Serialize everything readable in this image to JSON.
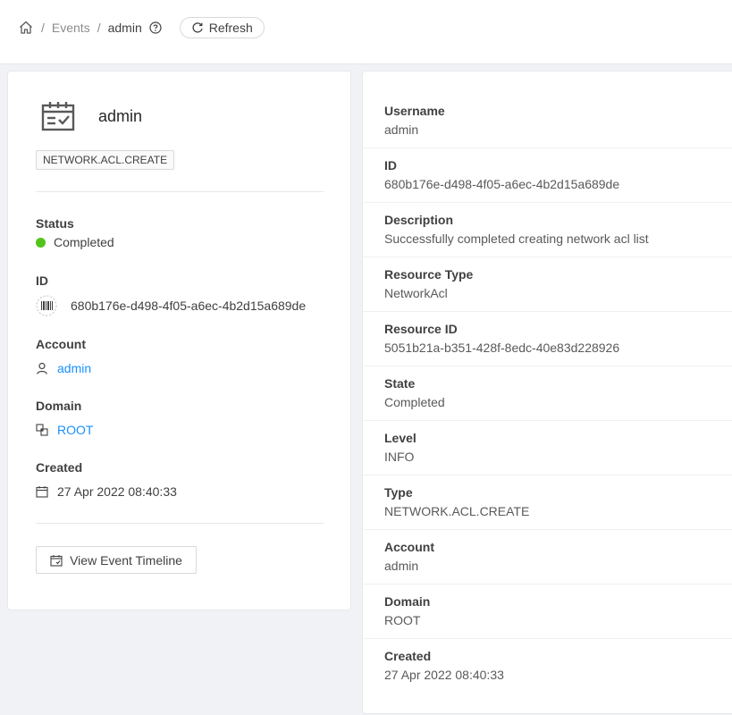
{
  "breadcrumb": {
    "items": [
      "Events",
      "admin"
    ],
    "refresh_label": "Refresh"
  },
  "resource": {
    "name": "admin",
    "type_tag": "NETWORK.ACL.CREATE"
  },
  "left_fields": {
    "status_label": "Status",
    "status_value": "Completed",
    "status_color": "#52c41a",
    "id_label": "ID",
    "id_value": "680b176e-d498-4f05-a6ec-4b2d15a689de",
    "account_label": "Account",
    "account_value": "admin",
    "domain_label": "Domain",
    "domain_value": "ROOT",
    "created_label": "Created",
    "created_value": "27 Apr 2022 08:40:33"
  },
  "timeline_button": "View Event Timeline",
  "details": [
    {
      "label": "Username",
      "value": "admin"
    },
    {
      "label": "ID",
      "value": "680b176e-d498-4f05-a6ec-4b2d15a689de"
    },
    {
      "label": "Description",
      "value": "Successfully completed creating network acl list"
    },
    {
      "label": "Resource Type",
      "value": "NetworkAcl"
    },
    {
      "label": "Resource ID",
      "value": "5051b21a-b351-428f-8edc-40e83d228926"
    },
    {
      "label": "State",
      "value": "Completed"
    },
    {
      "label": "Level",
      "value": "INFO"
    },
    {
      "label": "Type",
      "value": "NETWORK.ACL.CREATE"
    },
    {
      "label": "Account",
      "value": "admin"
    },
    {
      "label": "Domain",
      "value": "ROOT"
    },
    {
      "label": "Created",
      "value": "27 Apr 2022 08:40:33"
    }
  ],
  "colors": {
    "link": "#1890ff",
    "status_completed": "#52c41a"
  }
}
